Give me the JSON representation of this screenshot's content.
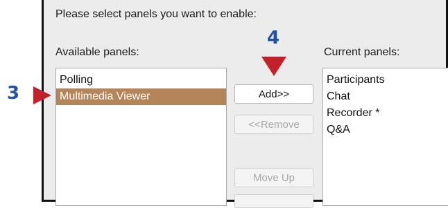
{
  "dialog": {
    "instruction": "Please select panels you want to enable:",
    "available_label": "Available panels:",
    "current_label": "Current panels:"
  },
  "available_panels": [
    {
      "label": "Polling",
      "selected": false
    },
    {
      "label": "Multimedia Viewer",
      "selected": true
    }
  ],
  "current_panels": [
    {
      "label": "Participants"
    },
    {
      "label": "Chat"
    },
    {
      "label": "Recorder *"
    },
    {
      "label": "Q&A"
    }
  ],
  "buttons": {
    "add": "Add>>",
    "remove": "<<Remove",
    "move_up": "Move Up"
  },
  "annotations": {
    "step_3": "3",
    "step_4": "4",
    "arrow_color": "#c0212b",
    "marker_color": "#2450a4"
  },
  "colors": {
    "selection": "#b4855a",
    "dialog_bg": "#ececec"
  }
}
